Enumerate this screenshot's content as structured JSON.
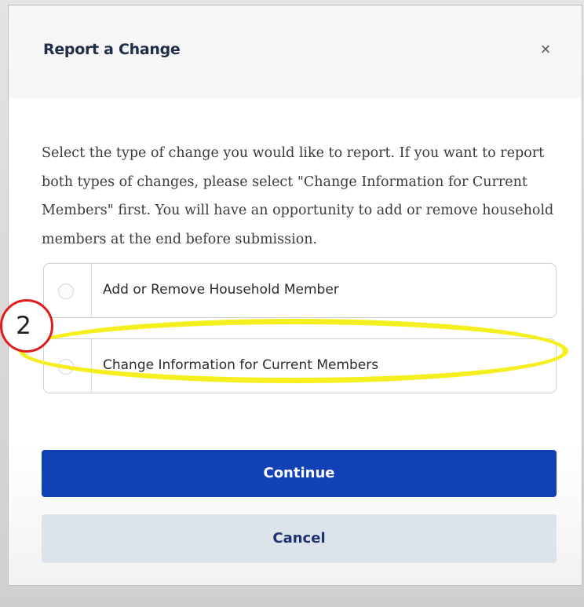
{
  "modal": {
    "title": "Report a Change",
    "close_glyph": "×",
    "instructions": "Select the type of change you would like to report. If you want to report both types of changes, please select \"Change Information for Current Members\" first. You will have an opportunity to add or remove household members at the end before submission.",
    "options": [
      {
        "label": "Add or Remove Household Member",
        "selected": false
      },
      {
        "label": "Change Information for Current Members",
        "selected": false
      }
    ],
    "continue_label": "Continue",
    "cancel_label": "Cancel"
  },
  "annotation": {
    "step_number": "2",
    "highlight_color": "#f6ef1f",
    "badge_border_color": "#e01b1b"
  },
  "colors": {
    "primary_button": "#1241b6",
    "secondary_button": "#dde3ea",
    "title_text": "#1f2d46"
  }
}
